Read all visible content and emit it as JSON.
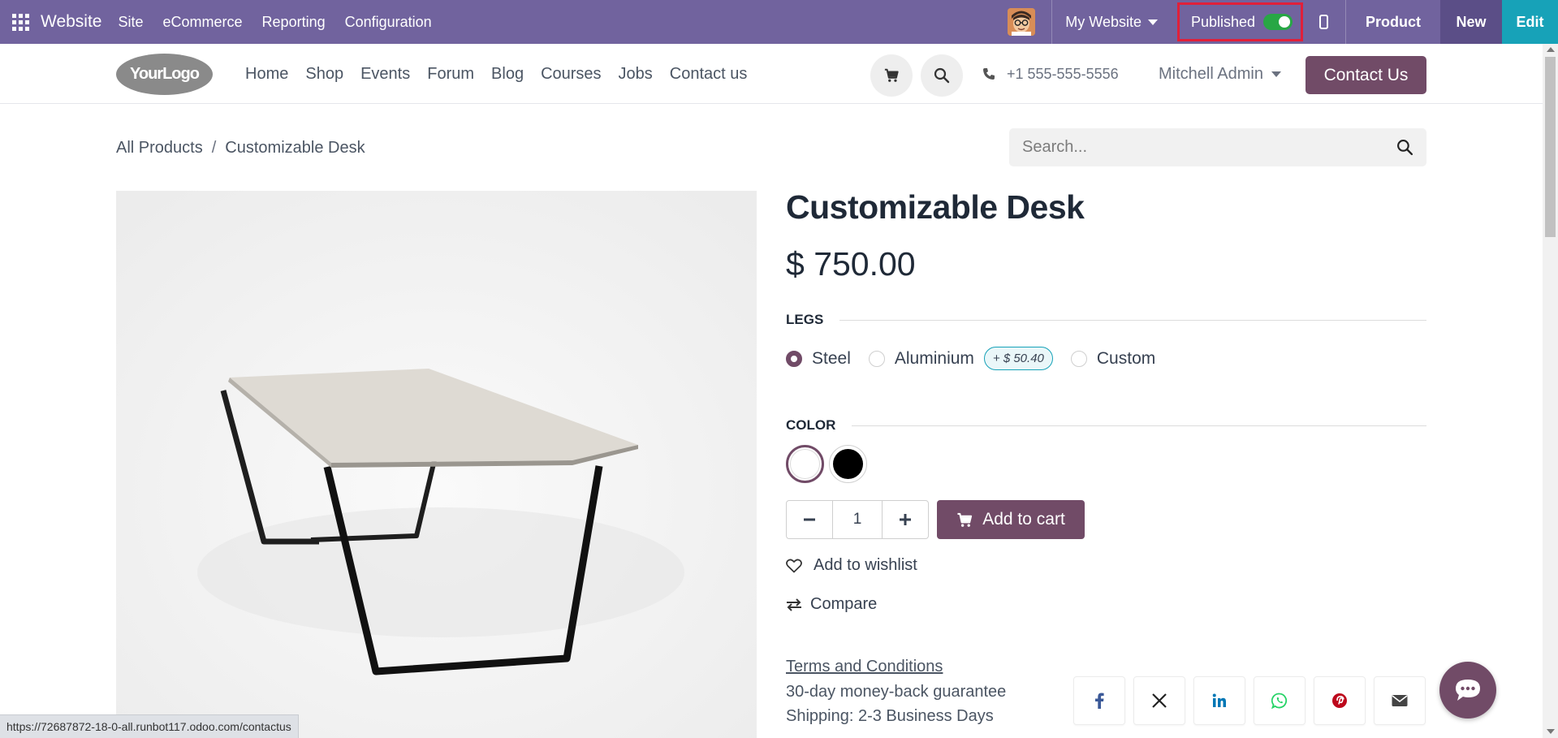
{
  "adminbar": {
    "brand": "Website",
    "menus": [
      "Site",
      "eCommerce",
      "Reporting",
      "Configuration"
    ],
    "website_selector": "My Website",
    "published_label": "Published",
    "published": true,
    "product_label": "Product",
    "new_label": "New",
    "edit_label": "Edit",
    "colors": {
      "bar": "#71639e",
      "new": "#5b4e87",
      "edit": "#17a2b8",
      "toggle_on": "#28a745"
    }
  },
  "siteheader": {
    "logo_text": "YourLogo",
    "nav": [
      "Home",
      "Shop",
      "Events",
      "Forum",
      "Blog",
      "Courses",
      "Jobs",
      "Contact us"
    ],
    "phone": "+1 555-555-5556",
    "user": "Mitchell Admin",
    "contact_button": "Contact Us",
    "icons": [
      "cart-icon",
      "search-icon",
      "phone-icon"
    ]
  },
  "breadcrumb": {
    "items": [
      "All Products",
      "Customizable Desk"
    ],
    "separator": "/"
  },
  "search": {
    "placeholder": "Search..."
  },
  "product": {
    "name": "Customizable Desk",
    "price": "$ 750.00",
    "attributes": {
      "legs": {
        "label": "LEGS",
        "options": [
          {
            "label": "Steel",
            "selected": true
          },
          {
            "label": "Aluminium",
            "selected": false,
            "extra": "+ $ 50.40"
          },
          {
            "label": "Custom",
            "selected": false
          }
        ]
      },
      "color": {
        "label": "COLOR",
        "options": [
          {
            "name": "White",
            "hex": "#ffffff",
            "selected": true
          },
          {
            "name": "Black",
            "hex": "#000000",
            "selected": false
          }
        ]
      }
    },
    "quantity": "1",
    "add_to_cart": "Add to cart",
    "wishlist": "Add to wishlist",
    "compare": "Compare",
    "terms": "Terms and Conditions",
    "guarantee": "30-day money-back guarantee",
    "shipping": "Shipping: 2-3 Business Days",
    "share": [
      "facebook-icon",
      "x-icon",
      "linkedin-icon",
      "whatsapp-icon",
      "pinterest-icon",
      "email-icon"
    ],
    "accent": "#714b67"
  },
  "status_url": "https://72687872-18-0-all.runbot117.odoo.com/contactus"
}
